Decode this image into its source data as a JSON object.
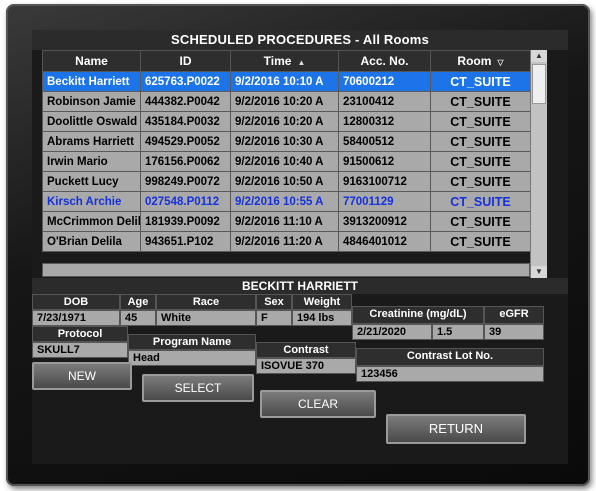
{
  "title": "SCHEDULED PROCEDURES - All Rooms",
  "columns": [
    "Name",
    "ID",
    "Time",
    "Acc. No.",
    "Room"
  ],
  "sort_icon": "triangle-up-icon",
  "filter_icon": "triangle-down-icon",
  "rows": [
    {
      "name": "Beckitt Harriett",
      "id": "625763.P0022",
      "time": "9/2/2016 10:10 A",
      "acc": "70600212",
      "room": "CT_SUITE"
    },
    {
      "name": "Robinson Jamie",
      "id": "444382.P0042",
      "time": "9/2/2016 10:20 A",
      "acc": "23100412",
      "room": "CT_SUITE"
    },
    {
      "name": "Doolittle Oswald",
      "id": "435184.P0032",
      "time": "9/2/2016 10:20 A",
      "acc": "12800312",
      "room": "CT_SUITE"
    },
    {
      "name": "Abrams Harriett",
      "id": "494529.P0052",
      "time": "9/2/2016 10:30 A",
      "acc": "58400512",
      "room": "CT_SUITE"
    },
    {
      "name": "Irwin Mario",
      "id": "176156.P0062",
      "time": "9/2/2016 10:40 A",
      "acc": "91500612",
      "room": "CT_SUITE"
    },
    {
      "name": "Puckett Lucy",
      "id": "998249.P0072",
      "time": "9/2/2016 10:50 A",
      "acc": "9163100712",
      "room": "CT_SUITE"
    },
    {
      "name": "Kirsch Archie",
      "id": "027548.P0112",
      "time": "9/2/2016 10:55 A",
      "acc": "77001129",
      "room": "CT_SUITE"
    },
    {
      "name": "McCrimmon Delila",
      "id": "181939.P0092",
      "time": "9/2/2016 11:10 A",
      "acc": "3913200912",
      "room": "CT_SUITE"
    },
    {
      "name": "O'Brian Delila",
      "id": "943651.P102",
      "time": "9/2/2016 11:20 A",
      "acc": "4846401012",
      "room": "CT_SUITE"
    }
  ],
  "selected_row": 0,
  "highlight_row": 6,
  "colors": {
    "selected": "#1d74e8",
    "highlight_text": "#1530e0",
    "row_bg": "#a9a9a9",
    "header_bg": "#2e2e2e"
  },
  "detail": {
    "patient_name": "BECKITT HARRIETT",
    "labels": {
      "dob": "DOB",
      "age": "Age",
      "race": "Race",
      "sex": "Sex",
      "weight": "Weight",
      "creatinine": "Creatinine (mg/dL)",
      "egfr": "eGFR",
      "protocol": "Protocol",
      "program": "Program Name",
      "contrast": "Contrast",
      "lot": "Contrast Lot No."
    },
    "values": {
      "dob": "7/23/1971",
      "age": "45",
      "race": "White",
      "sex": "F",
      "weight": "194 lbs",
      "creatinine_date": "2/21/2020",
      "creatinine": "1.5",
      "egfr": "39",
      "protocol": "SKULL7",
      "program": "Head",
      "contrast": "ISOVUE 370",
      "lot": "123456"
    }
  },
  "buttons": {
    "new": "NEW",
    "select": "SELECT",
    "clear": "CLEAR",
    "return": "RETURN"
  }
}
